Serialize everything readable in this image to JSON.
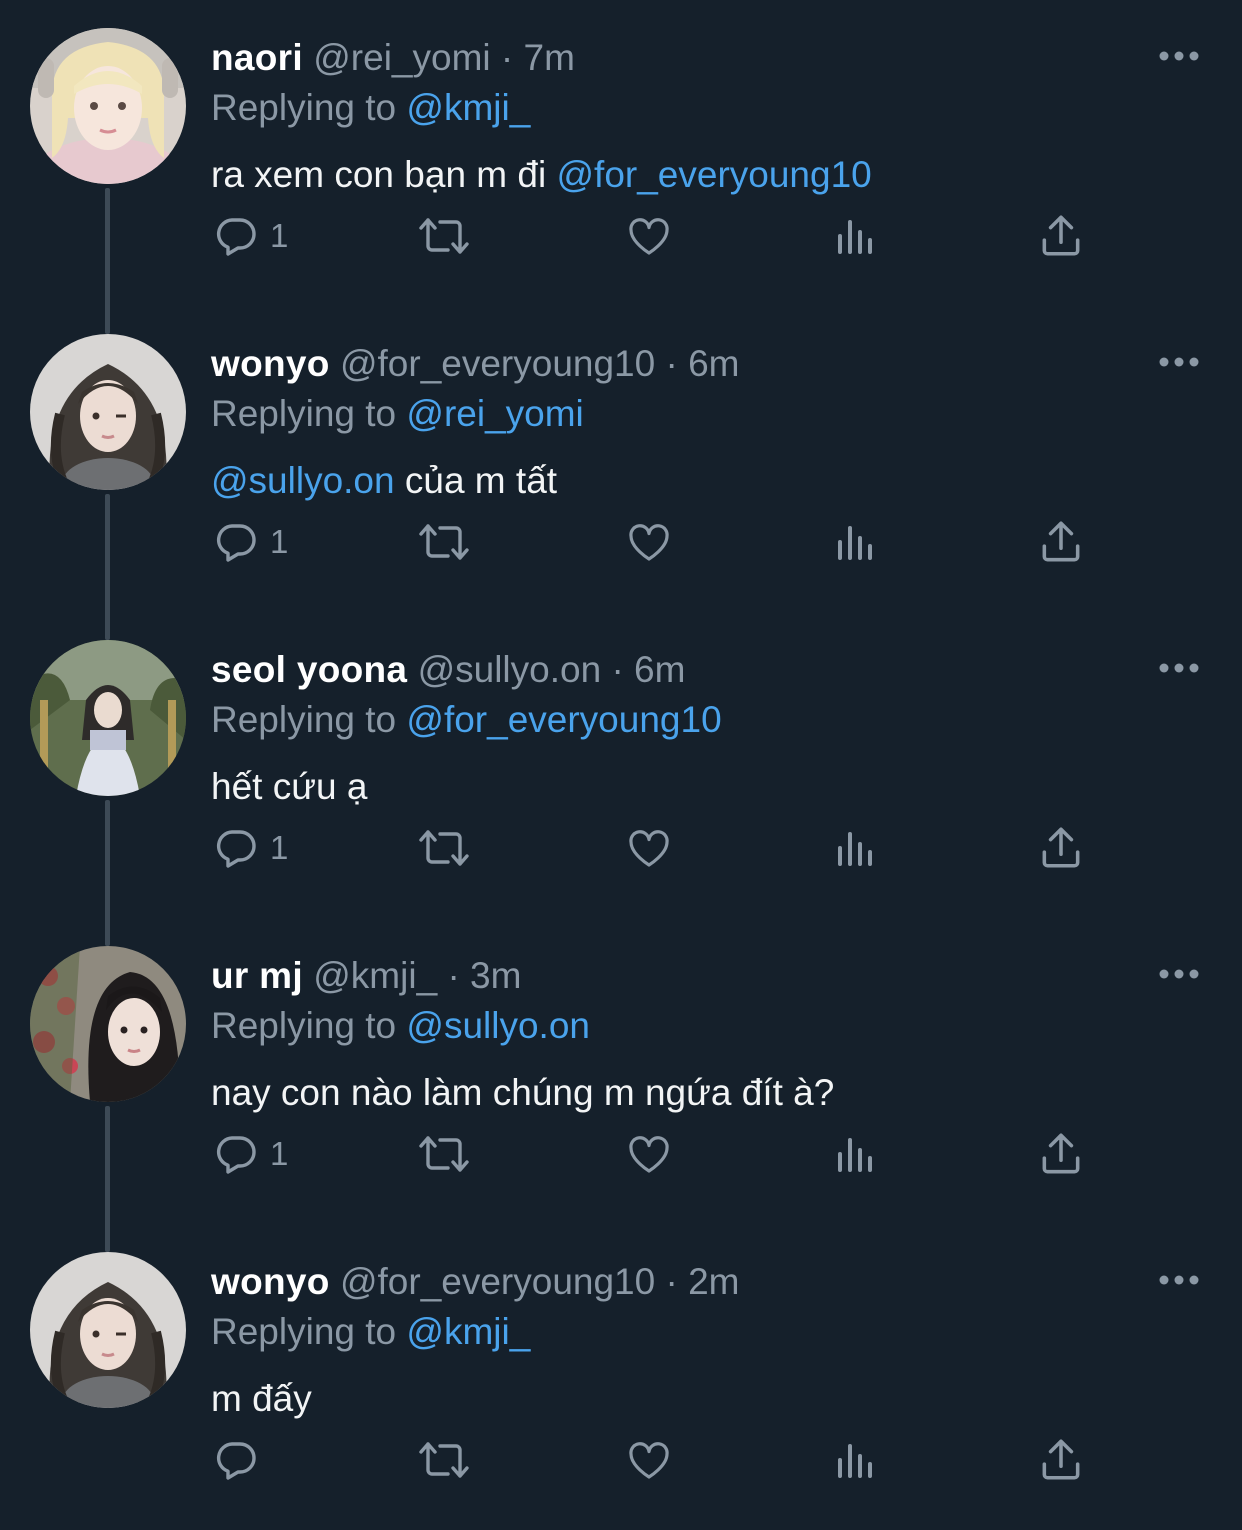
{
  "colors": {
    "background": "#15202b",
    "name": "#ffffff",
    "secondary": "#8b98a5",
    "mention": "#4aa3ec",
    "thread_line": "#3d4a56"
  },
  "action_icons": [
    "reply-icon",
    "retweet-icon",
    "like-icon",
    "views-icon",
    "share-icon"
  ],
  "tweets": [
    {
      "name": "naori",
      "handle": "@rei_yomi",
      "separator": "·",
      "time": "7m",
      "replying_prefix": "Replying to",
      "replying_to": "@kmji_",
      "text_before": "ra xem con bạn m đi ",
      "text_mention": "@for_everyoung10",
      "text_after": "",
      "reply_count": "1"
    },
    {
      "name": "wonyo",
      "handle": "@for_everyoung10",
      "separator": "·",
      "time": "6m",
      "replying_prefix": "Replying to",
      "replying_to": "@rei_yomi",
      "text_before": "",
      "text_mention": "@sullyo.on",
      "text_after": " của m tất",
      "reply_count": "1"
    },
    {
      "name": "seol yoona",
      "handle": "@sullyo.on",
      "separator": "·",
      "time": "6m",
      "replying_prefix": "Replying to",
      "replying_to": "@for_everyoung10",
      "text_before": "hết cứu ạ",
      "text_mention": "",
      "text_after": "",
      "reply_count": "1"
    },
    {
      "name": "ur mj",
      "handle": "@kmji_",
      "separator": "·",
      "time": "3m",
      "replying_prefix": "Replying to",
      "replying_to": "@sullyo.on",
      "text_before": "nay con nào làm chúng m ngứa đít à?",
      "text_mention": "",
      "text_after": "",
      "reply_count": "1"
    },
    {
      "name": "wonyo",
      "handle": "@for_everyoung10",
      "separator": "·",
      "time": "2m",
      "replying_prefix": "Replying to",
      "replying_to": "@kmji_",
      "text_before": "m đấy",
      "text_mention": "",
      "text_after": "",
      "reply_count": ""
    }
  ]
}
